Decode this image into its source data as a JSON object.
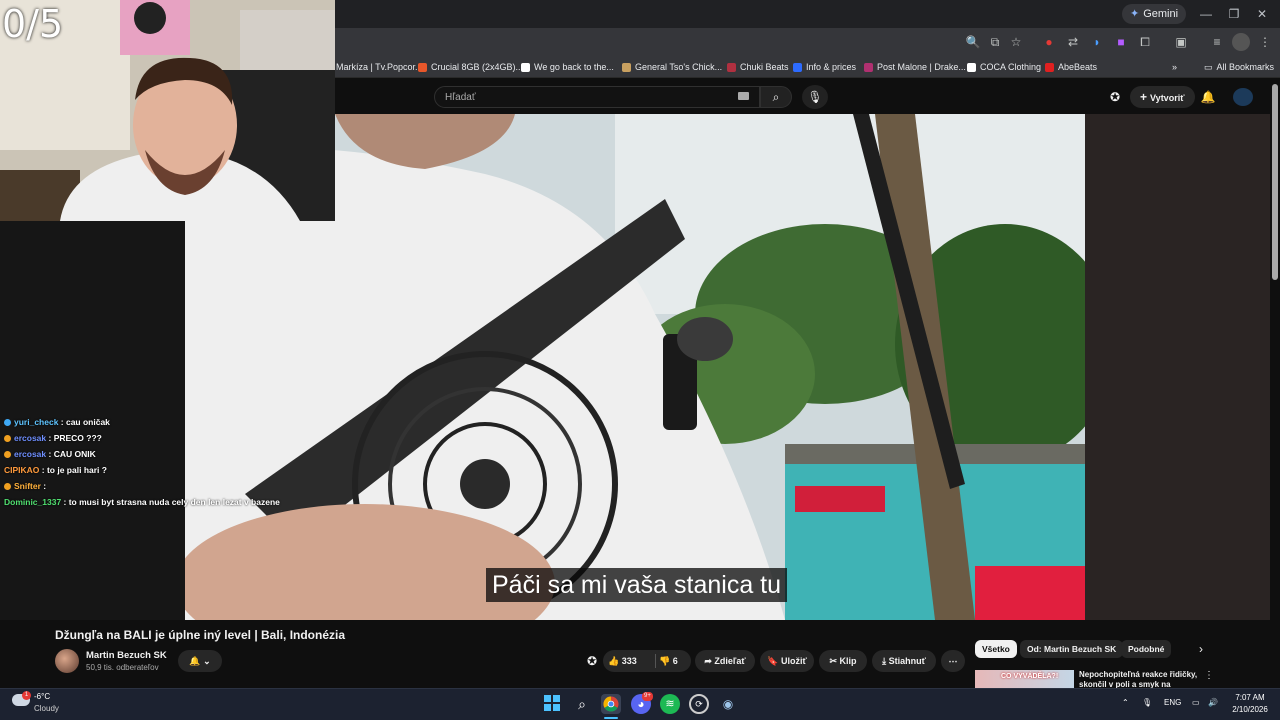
{
  "stream": {
    "counter": "0/5"
  },
  "browser": {
    "gemini_label": "Gemini",
    "bookmarks": [
      "Markíza | Tv.Popcor...",
      "Crucial 8GB (2x4GB)...",
      "We go back to the...",
      "General Tso's Chick...",
      "Chuki Beats",
      "Info & prices",
      "Post Malone | Drake...",
      "COCA Clothing",
      "AbeBeats"
    ],
    "all_bookmarks": "All Bookmarks"
  },
  "youtube": {
    "search_placeholder": "Hľadať",
    "create_label": "Vytvoriť",
    "subtitle": "Páči sa mi vaša stanica tu",
    "video_title": "Džungľa na BALI je úplne iný level | Bali, Indonézia",
    "channel_name": "Martin Bezuch SK",
    "subscribers": "50,9 tis. odberateľov",
    "likes": "333",
    "dislikes": "6",
    "share_label": "Zdieľať",
    "save_label": "Uložiť",
    "clip_label": "Klip",
    "download_label": "Stiahnuť",
    "chips": [
      "Všetko",
      "Od: Martin Bezuch SK",
      "Podobné"
    ],
    "rec_title": "Nepochopiteľná reakce řidičky, skončil v poli a smyk na ledov...",
    "rec_thumb_text": "CO VYVÁDĚLA?!"
  },
  "chat": [
    {
      "user": "yuri_check",
      "color": "#5ec4ff",
      "badge": "#3fa9f5",
      "message": ": cau oničak"
    },
    {
      "user": "ercosak",
      "color": "#6f8fff",
      "badge": "#f0a020",
      "message": ": PRECO ???"
    },
    {
      "user": "ercosak",
      "color": "#6f8fff",
      "badge": "#f0a020",
      "message": ": CAU ONIK"
    },
    {
      "user": "CIPIKAO",
      "color": "#ff9a3c",
      "badge": "",
      "message": ": to je pali hari ?"
    },
    {
      "user": "Snifter",
      "color": "#ffb13c",
      "badge": "#f0a020",
      "message": ":"
    },
    {
      "user": "Dominic_1337",
      "color": "#50e070",
      "badge": "",
      "message": ": to musi byt strasna nuda cely den len lezat v bazene"
    }
  ],
  "taskbar": {
    "temperature": "-6°C",
    "condition": "Cloudy",
    "language": "ENG",
    "time": "7:07 AM",
    "date": "2/10/2026",
    "discord_badge": "9+"
  }
}
